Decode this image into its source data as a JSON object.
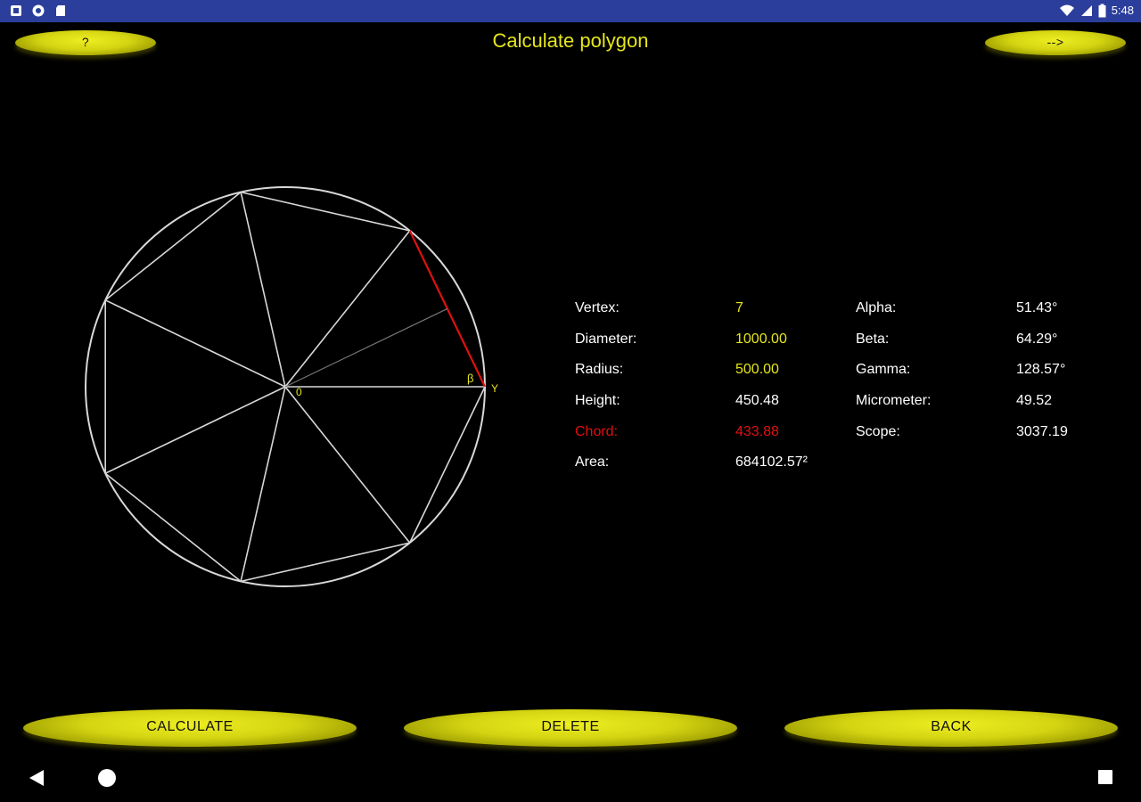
{
  "status_bar": {
    "time": "5:48",
    "left_icons": [
      "notification-app-icon",
      "settings-circle-icon",
      "sd-card-icon"
    ],
    "right_icons": [
      "wifi-icon",
      "cell-signal-icon",
      "battery-icon"
    ],
    "background": "#2c3e9c"
  },
  "header": {
    "title": "Calculate polygon",
    "help_label": "?",
    "next_label": "-->"
  },
  "diagram": {
    "vertex_label_o": "0",
    "beta_symbol": "β",
    "gamma_symbol": "Y",
    "line_color": "#d8d8d8",
    "chord_color": "#e01010"
  },
  "results": {
    "left": [
      {
        "label": "Vertex:",
        "value": "7",
        "style": "yellow"
      },
      {
        "label": "Diameter:",
        "value": "1000.00",
        "style": "yellow"
      },
      {
        "label": "Radius:",
        "value": "500.00",
        "style": "yellow"
      },
      {
        "label": "Height:",
        "value": "450.48",
        "style": "white"
      },
      {
        "label": "Chord:",
        "value": "433.88",
        "style": "red"
      },
      {
        "label": "Area:",
        "value": "684102.57²",
        "style": "white"
      }
    ],
    "right": [
      {
        "label": "Alpha:",
        "value": "51.43°"
      },
      {
        "label": "Beta:",
        "value": "64.29°"
      },
      {
        "label": "Gamma:",
        "value": "128.57°"
      },
      {
        "label": "Micrometer:",
        "value": "49.52"
      },
      {
        "label": "Scope:",
        "value": "3037.19"
      }
    ]
  },
  "actions": {
    "calculate_label": "CALCULATE",
    "delete_label": "DELETE",
    "back_label": "BACK"
  },
  "colors": {
    "accent_yellow": "#e6e61c",
    "background": "#000000"
  }
}
